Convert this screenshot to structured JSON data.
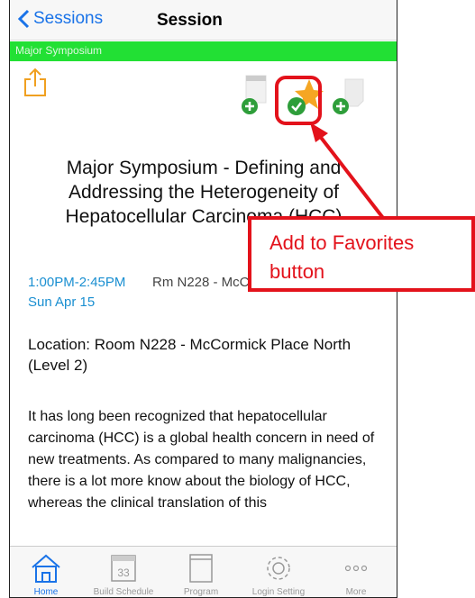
{
  "navbar": {
    "back_label": "Sessions",
    "title": "Session"
  },
  "category_bar": {
    "label": "Major Symposium",
    "color": "#22e034"
  },
  "toolbar": {
    "share_icon": "share-icon",
    "calendar_icon": "add-to-calendar-icon",
    "favorite_icon": "favorite-star-icon",
    "note_icon": "add-note-icon"
  },
  "session": {
    "title": "Major Symposium - Defining and Addressing the Heterogeneity of Hepatocellular Carcinoma (HCC)",
    "time": "1:00PM-2:45PM",
    "room": "Rm N228 - McCormick Place",
    "date": "Sun Apr 15",
    "location": "Location: Room N228 - McCormick Place North (Level 2)",
    "description": "It has long been recognized that hepatocellular carcinoma (HCC) is a global health concern in need of new treatments. As compared to many malignancies, there is a lot more know about the biology of HCC, whereas the clinical translation of this"
  },
  "annotation": {
    "callout_text": "Add to Favorites button",
    "color": "#e3121b"
  },
  "tabs": [
    {
      "label": "Home",
      "icon": "home-icon"
    },
    {
      "label": "Build Schedule",
      "icon": "calendar-icon"
    },
    {
      "label": "Program",
      "icon": "book-icon"
    },
    {
      "label": "Login Setting",
      "icon": "gear-icon"
    },
    {
      "label": "More",
      "icon": "more-dots-icon"
    }
  ]
}
